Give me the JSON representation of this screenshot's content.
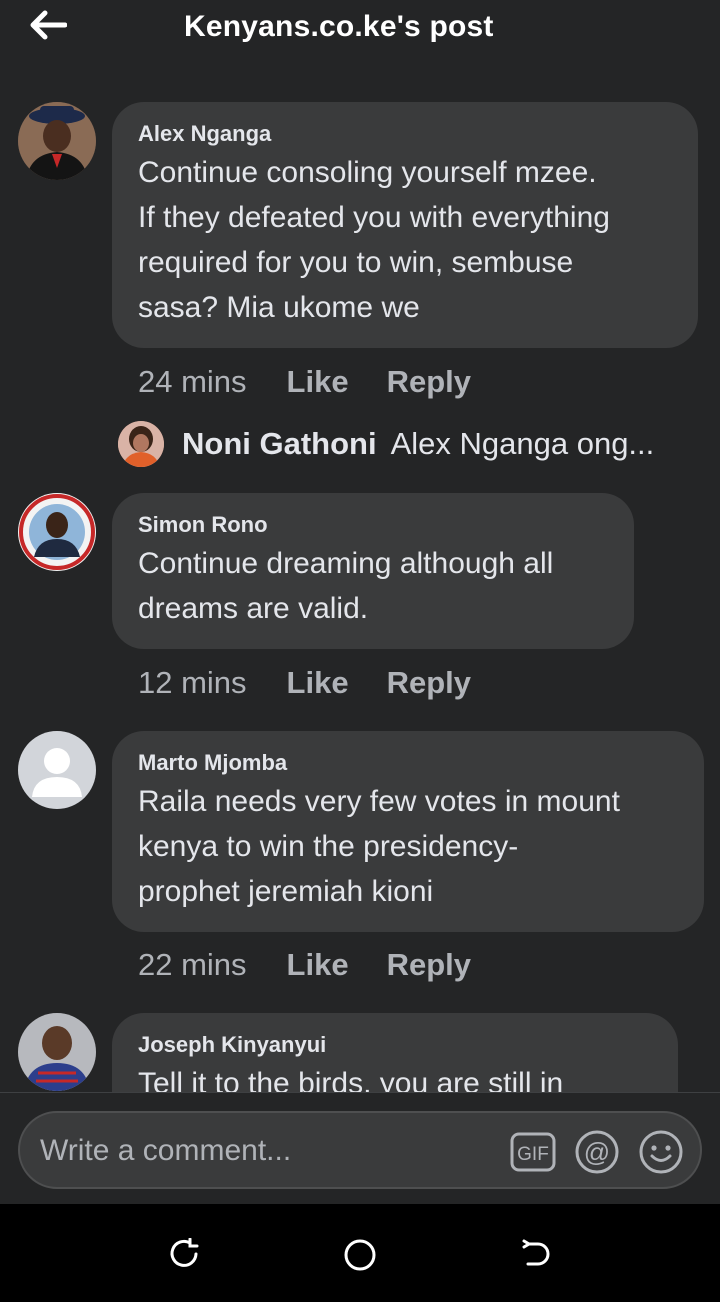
{
  "header": {
    "title": "Kenyans.co.ke's post"
  },
  "comments": [
    {
      "author": "Alex Nganga",
      "lines": [
        "Continue consoling yourself mzee.",
        "If they defeated you with everything",
        "required for you to win, sembuse",
        "sasa? Mia ukome we"
      ],
      "time": "24 mins",
      "like": "Like",
      "reply": "Reply"
    },
    {
      "author": "Simon Rono",
      "lines": [
        "Continue dreaming although all",
        "dreams are valid."
      ],
      "time": "12 mins",
      "like": "Like",
      "reply": "Reply"
    },
    {
      "author": "Marto Mjomba",
      "lines": [
        "Raila needs very few votes in mount",
        "kenya to win the presidency-",
        "prophet jeremiah kioni"
      ],
      "time": "22 mins",
      "like": "Like",
      "reply": "Reply"
    },
    {
      "author": "Joseph Kinyanyui",
      "lines": [
        "Tell it to the birds, you are still in"
      ]
    }
  ],
  "reply_preview": {
    "name": "Noni Gathoni",
    "snippet": "Alex Nganga ong..."
  },
  "composer": {
    "placeholder": "Write a comment...",
    "icons": [
      "gif-icon",
      "mention-icon",
      "emoji-icon"
    ]
  },
  "navbar": {
    "icons": [
      "recent-apps-icon",
      "home-icon",
      "back-icon"
    ]
  },
  "colors": {
    "background": "#242526",
    "bubble": "#3a3b3c",
    "text": "#e4e6eb",
    "secondary_text": "#b0b3b8",
    "navbar": "#000000"
  }
}
